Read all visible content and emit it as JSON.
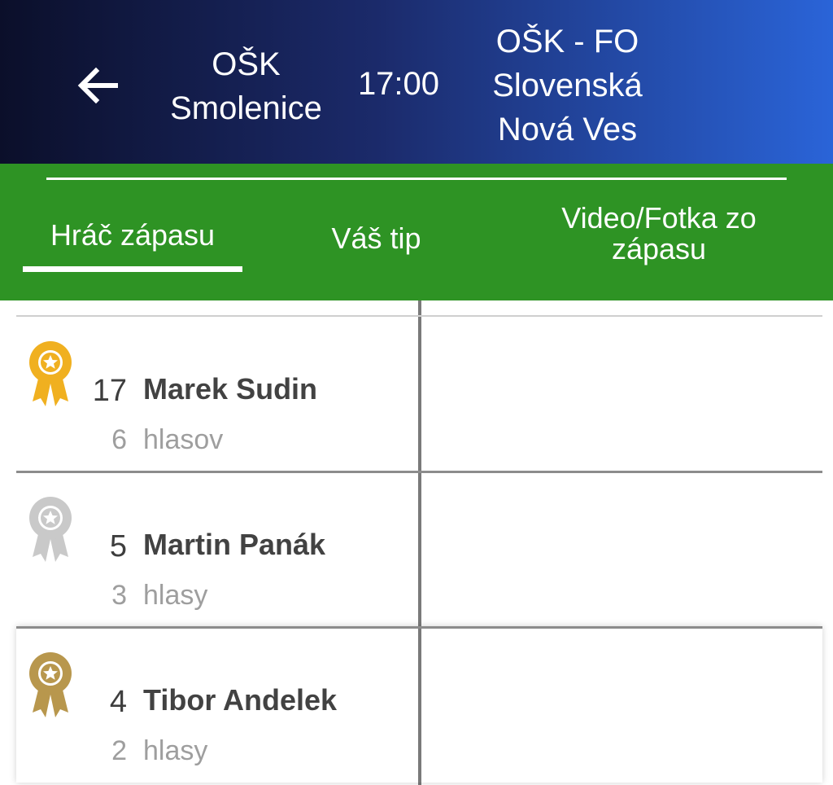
{
  "header": {
    "home_team_line1": "OŠK",
    "home_team_line2": "Smolenice",
    "time": "17:00",
    "away_team_line1": "OŠK - FO",
    "away_team_line2": "Slovenská",
    "away_team_line3": "Nová Ves",
    "back_icon": "arrow-left-icon"
  },
  "tabs": [
    {
      "label": "Hráč zápasu",
      "selected": true
    },
    {
      "label": "Váš tip",
      "selected": false
    },
    {
      "label_line1": "Video/Fotka zo",
      "label_line2": "zápasu",
      "selected": false
    }
  ],
  "players": [
    {
      "number": "17",
      "name": "Marek Sudin",
      "votes": "6",
      "votes_label": "hlasov",
      "medal": "gold",
      "medal_color": "#F0B020"
    },
    {
      "number": "5",
      "name": "Martin Panák",
      "votes": "3",
      "votes_label": "hlasy",
      "medal": "silver",
      "medal_color": "#C9C9C9"
    },
    {
      "number": "4",
      "name": "Tibor Andelek",
      "votes": "2",
      "votes_label": "hlasy",
      "medal": "bronze",
      "medal_color": "#B8974D"
    }
  ],
  "colors": {
    "header_start": "#0b0f2a",
    "header_end": "#2a64d8",
    "tab_bar": "#2e9324"
  }
}
